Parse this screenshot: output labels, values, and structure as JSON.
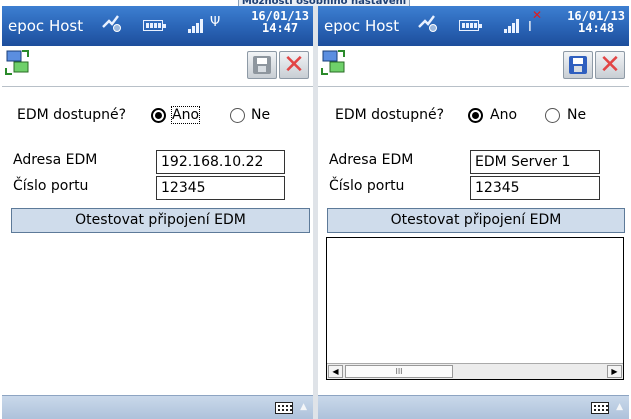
{
  "background_window": {
    "title": "Možnosti osobního nastavení"
  },
  "left_screen": {
    "app_title": "epoc Host",
    "date": "16/01/13",
    "time": "14:47",
    "edm_question": "EDM dostupné?",
    "radio_yes": "Ano",
    "radio_no": "Ne",
    "selected": "Ano",
    "address_label": "Adresa EDM",
    "address_value": "192.168.10.22",
    "port_label": "Číslo portu",
    "port_value": "12345",
    "test_button": "Otestovat připojení EDM"
  },
  "right_screen": {
    "app_title": "epoc Host",
    "date": "16/01/13",
    "time": "14:48",
    "edm_question": "EDM dostupné?",
    "radio_yes": "Ano",
    "radio_no": "Ne",
    "selected": "Ano",
    "address_label": "Adresa EDM",
    "address_value": "EDM Server 1",
    "port_label": "Číslo portu",
    "port_value": "12345",
    "test_button": "Otestovat připojení EDM",
    "scroll_thumb": "III"
  },
  "icons": {
    "sync": "sync-icon",
    "battery": "battery-icon",
    "signal": "signal-icon",
    "antenna": "antenna-icon",
    "connection": "connection-icon",
    "save": "save-icon",
    "close": "close-icon",
    "keyboard": "keyboard-icon"
  },
  "colors": {
    "titlebar": "#2b66b8",
    "button_bg": "#cfdceb",
    "close_red": "#e24545",
    "save_disabled": "#8e969e",
    "save_enabled": "#2f5fbf"
  }
}
